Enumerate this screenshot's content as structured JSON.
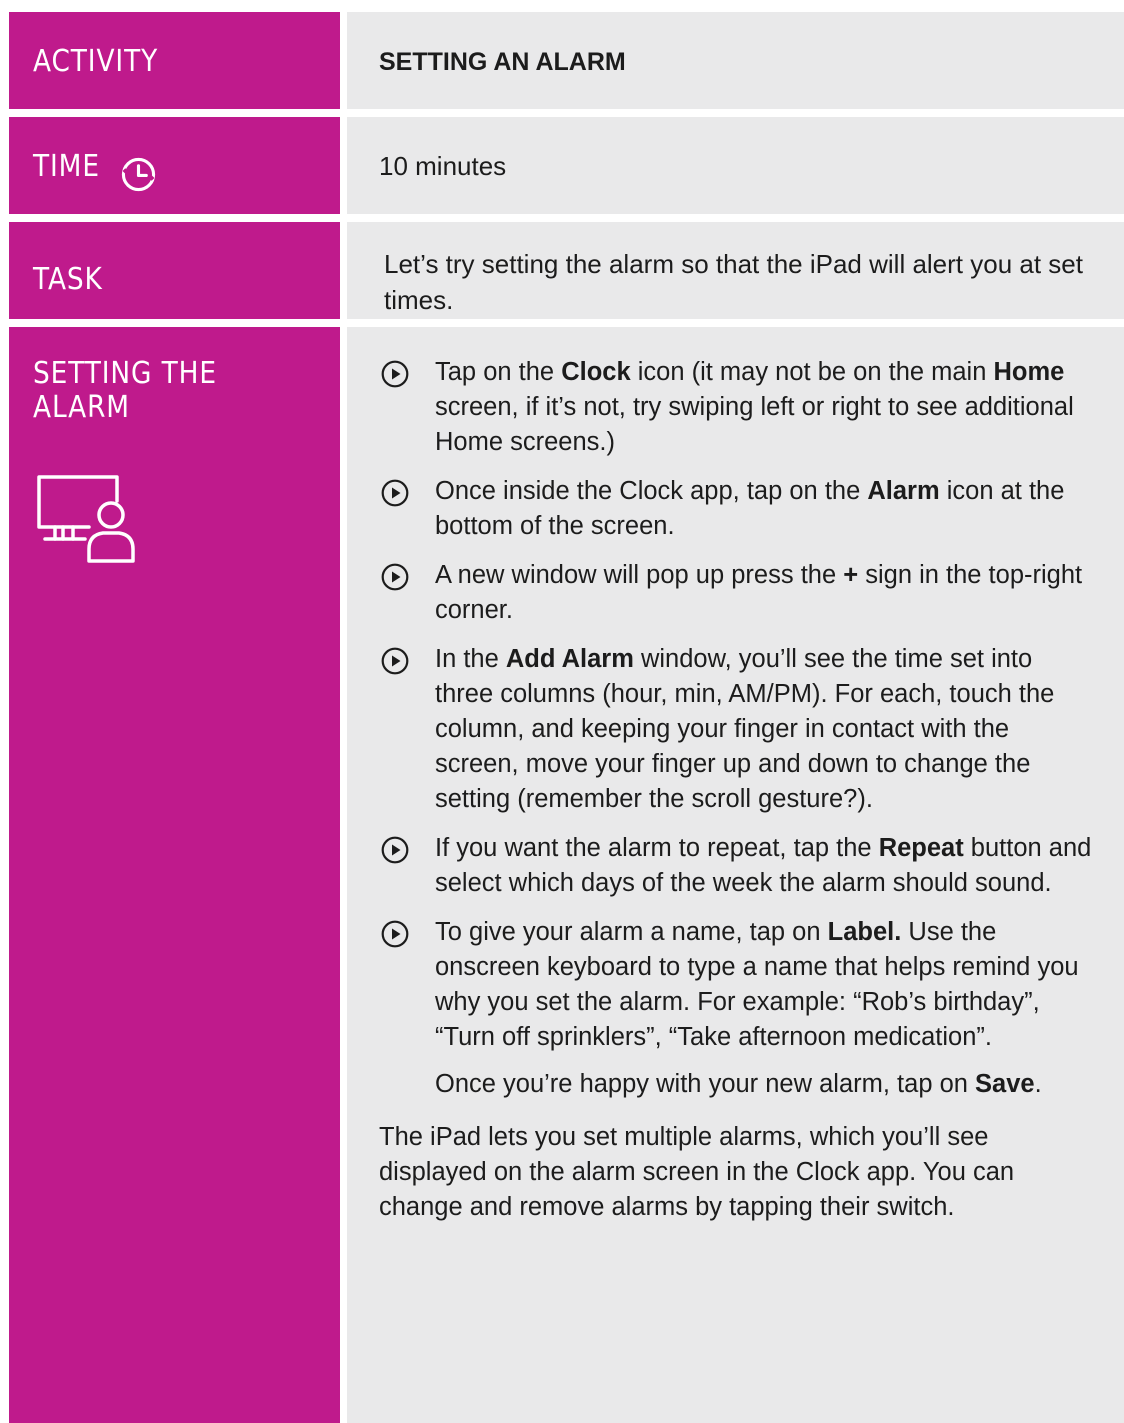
{
  "rows": {
    "activity": {
      "label": "ACTIVITY",
      "value": "SETTING AN ALARM"
    },
    "time": {
      "label": "TIME",
      "value": "10 minutes"
    },
    "task": {
      "label": "TASK",
      "value": "Let’s try setting the alarm so that the iPad will alert you at set times."
    },
    "setting": {
      "label": "SETTING THE ALARM"
    }
  },
  "steps": [
    {
      "parts": [
        "Tap on the ",
        "Clock",
        " icon (it may not be on the main ",
        "Home",
        " screen, if it’s not, try swiping left or right to see additional Home screens.)"
      ]
    },
    {
      "parts": [
        "Once inside the Clock app, tap on the ",
        "Alarm",
        " icon at the bottom of the screen."
      ]
    },
    {
      "parts": [
        "A new window will pop up press the ",
        "+",
        " sign in the top-right corner."
      ]
    },
    {
      "parts": [
        "In the ",
        "Add Alarm",
        " window, you’ll see the time set into three columns (hour, min, AM/PM). For each, touch the column, and keeping your finger in contact with the screen, move your finger up and down to change the setting (remember the scroll gesture?).",
        "",
        ""
      ]
    },
    {
      "parts": [
        "If you want the alarm to repeat, tap the ",
        "Repeat",
        " button and select which days of the week the alarm should sound."
      ]
    },
    {
      "parts": [
        "To give your alarm a name, tap on ",
        "Label.",
        " Use the onscreen keyboard to type a name that helps remind you why you set the alarm. For example: “Rob’s birthday”, “Turn off sprinklers”, “Take afternoon medication”."
      ]
    }
  ],
  "save_line": [
    "Once you’re happy with your new alarm, tap on ",
    "Save",
    "."
  ],
  "outro": "The iPad lets you set multiple alarms, which you’ll see displayed on the alarm screen in the Clock app. You can change and remove alarms by tapping their switch.",
  "colors": {
    "accent": "#bf1a8c",
    "panel": "#e9e9ea",
    "text": "#1c1c1c"
  },
  "icons": {
    "time": "clock-icon",
    "setting": "screen-user-icon",
    "bullet": "play-circle-icon"
  }
}
